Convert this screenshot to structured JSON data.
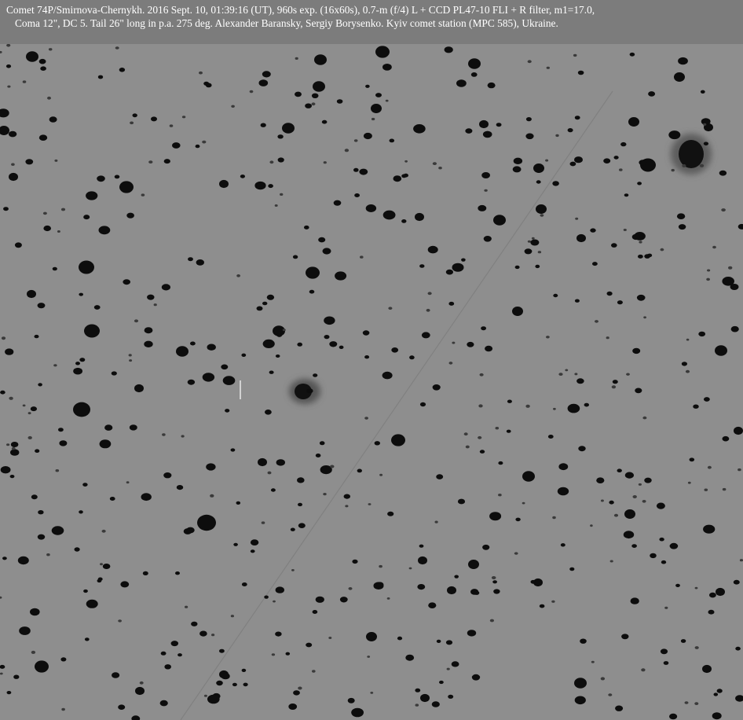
{
  "caption": {
    "line1": "Comet 74P/Smirnova-Chernykh. 2016 Sept. 10, 01:39:16 (UT), 960s exp. (16x60s), 0.7-m (f/4) L + CCD PL47-10 FLI + R filter, m1=17.0,",
    "line2": "Coma 12\", DC 5. Tail 26\" long in p.a. 275 deg. Alexander Baransky, Sergiy Borysenko. Kyiv comet station (MPC 585), Ukraine."
  },
  "image": {
    "subject": "Comet 74P/Smirnova-Chernykh",
    "rendering": "inverted-grayscale-star-field",
    "colors": {
      "sky_background": "#8e8e8e",
      "star": "#0b0b0b",
      "caption_band": "#7c7c7c",
      "caption_text": "#ffffff"
    }
  }
}
